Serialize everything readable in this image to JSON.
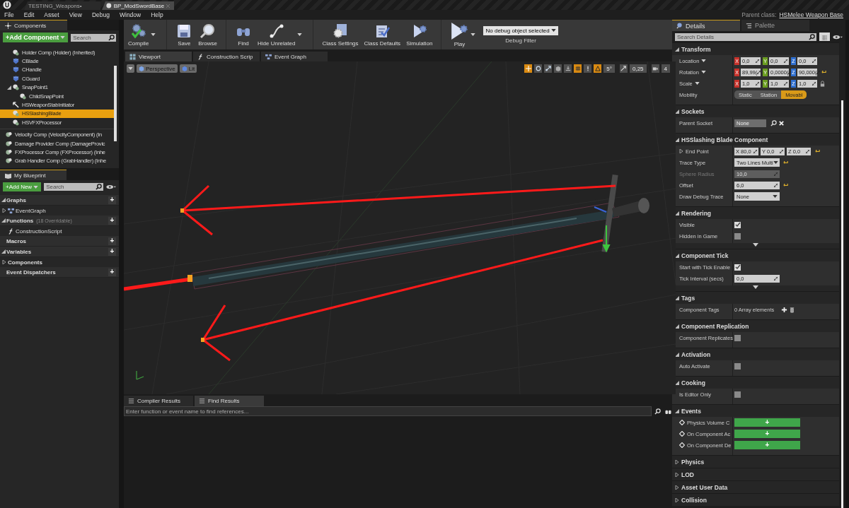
{
  "window": {
    "tabs": [
      {
        "label": "TESTING_Weapons•",
        "selected": false
      },
      {
        "label": "BP_ModSwordBase",
        "selected": true
      }
    ],
    "parent_class_label": "Parent class:",
    "parent_class": "HSMelee Weapon Base"
  },
  "menu": [
    "File",
    "Edit",
    "Asset",
    "View",
    "Debug",
    "Window",
    "Help"
  ],
  "components_panel": {
    "title": "Components",
    "add_button": "+Add Component",
    "search_placeholder": "Search",
    "items": [
      {
        "label": "Holder Comp (Holder) (Inherited)",
        "kind": "scene",
        "selected": false
      },
      {
        "label": "CBlade",
        "kind": "mesh",
        "selected": false
      },
      {
        "label": "CHandle",
        "kind": "mesh",
        "selected": false
      },
      {
        "label": "CGuard",
        "kind": "mesh",
        "selected": false
      },
      {
        "label": "SnapPoint1",
        "kind": "scene",
        "selected": false,
        "expanded": true,
        "children": [
          {
            "label": "ChildSnapPoint",
            "kind": "scene",
            "selected": false
          }
        ]
      },
      {
        "label": "HSWeaponStabInitiator",
        "kind": "arrow",
        "selected": false
      },
      {
        "label": "HSSlashingBlade",
        "kind": "scene",
        "selected": true
      },
      {
        "label": "HSVFXProcessor",
        "kind": "scene",
        "selected": false
      }
    ],
    "inherited_items": [
      {
        "label": "Velocity Comp (VelocityComponent) (In",
        "kind": "actor",
        "selected": false
      },
      {
        "label": "Damage Provider Comp (DamageProvic",
        "kind": "actor",
        "selected": false
      },
      {
        "label": "FXProcessor Comp (FXProcessor) (Inhe",
        "kind": "actor",
        "selected": false
      },
      {
        "label": "Grab Handler Comp (GrabHandler) (Inhe",
        "kind": "actor",
        "selected": false
      }
    ]
  },
  "blueprint_panel": {
    "title": "My Blueprint",
    "add_button": "+Add New",
    "search_placeholder": "Search",
    "sections": [
      {
        "label": "Graphs",
        "expanded": true,
        "add": "+",
        "children": [
          {
            "label": "EventGraph",
            "kind": "graph",
            "expanded": false
          }
        ]
      },
      {
        "label": "Functions",
        "note": "(18 Overridable)",
        "expanded": true,
        "add": "+",
        "children": [
          {
            "label": "ConstructionScript",
            "kind": "function"
          }
        ]
      },
      {
        "label": "Macros",
        "add": "+"
      },
      {
        "label": "Variables",
        "expanded": true,
        "add": "+",
        "children": [
          {
            "label": "Components",
            "kind": "category",
            "expanded": false
          }
        ]
      },
      {
        "label": "Event Dispatchers",
        "add": "+"
      }
    ]
  },
  "toolbar": [
    {
      "label": "Compile",
      "dropdown": true
    },
    {
      "label": "Save",
      "dropdown": false
    },
    {
      "label": "Browse",
      "dropdown": false
    },
    {
      "label": "Find",
      "dropdown": false
    },
    {
      "label": "Hide Unrelated",
      "dropdown": true
    },
    {
      "label": "Class Settings",
      "dropdown": false
    },
    {
      "label": "Class Defaults",
      "dropdown": false
    },
    {
      "label": "Simulation",
      "dropdown": false
    },
    {
      "label": "Play",
      "dropdown": true
    }
  ],
  "debug_filter": {
    "value": "No debug object selected",
    "label": "Debug Filter"
  },
  "editor_tabs": [
    {
      "label": "Viewport",
      "selected": true
    },
    {
      "label": "Construction Scrip",
      "selected": false
    },
    {
      "label": "Event Graph",
      "selected": false
    }
  ],
  "viewport": {
    "view_mode": "Perspective",
    "lighting": "Lit",
    "controls": [
      {
        "kind": "translate",
        "on": true
      },
      {
        "kind": "rotate",
        "on": false
      },
      {
        "kind": "scale",
        "on": false
      },
      {
        "kind": "world",
        "on": false
      },
      {
        "kind": "surface",
        "on": false
      },
      {
        "kind": "grid",
        "on": true
      },
      {
        "kind": "alert",
        "on": false
      },
      {
        "kind": "angle",
        "on": true
      },
      {
        "kind": "value",
        "text": "5°"
      },
      {
        "kind": "resize",
        "on": false
      },
      {
        "kind": "value",
        "text": "0,25"
      },
      {
        "kind": "camera",
        "on": false
      },
      {
        "kind": "value",
        "text": "4"
      }
    ]
  },
  "results_panel": {
    "tabs": [
      {
        "label": "Compiler Results",
        "selected": false
      },
      {
        "label": "Find Results",
        "selected": true
      }
    ],
    "search_placeholder": "Enter function or event name to find references..."
  },
  "details_panel": {
    "tabs": [
      {
        "label": "Details",
        "selected": true
      },
      {
        "label": "Palette",
        "selected": false
      }
    ],
    "search_placeholder": "Search Details",
    "sections": [
      {
        "title": "Transform",
        "expanded": true,
        "advanced": false,
        "rows": [
          {
            "kind": "vector",
            "label": "Location",
            "menu": true,
            "reset": false,
            "lock": false,
            "axes": [
              {
                "axis": "X",
                "value": "0,0",
                "color": "#c8322b"
              },
              {
                "axis": "Y",
                "value": "0,0",
                "color": "#6b9e21"
              },
              {
                "axis": "Z",
                "value": "0,0",
                "color": "#2f6fd0"
              }
            ]
          },
          {
            "kind": "vector",
            "label": "Rotation",
            "menu": true,
            "reset": true,
            "lock": false,
            "axes": [
              {
                "axis": "X",
                "value": "89,99(",
                "color": "#c8322b"
              },
              {
                "axis": "Y",
                "value": "0,0000(",
                "color": "#6b9e21"
              },
              {
                "axis": "Z",
                "value": "90,000(",
                "color": "#2f6fd0"
              }
            ]
          },
          {
            "kind": "vector",
            "label": "Scale",
            "menu": true,
            "reset": false,
            "lock": true,
            "axes": [
              {
                "axis": "X",
                "value": "1,0",
                "color": "#c8322b"
              },
              {
                "axis": "Y",
                "value": "1,0",
                "color": "#6b9e21"
              },
              {
                "axis": "Z",
                "value": "1,0",
                "color": "#2f6fd0"
              }
            ]
          },
          {
            "kind": "segmented",
            "label": "Mobility",
            "options": [
              {
                "label": "Static",
                "selected": false
              },
              {
                "label": "Station",
                "selected": false
              },
              {
                "label": "Movabl",
                "selected": true
              }
            ]
          }
        ]
      },
      {
        "title": "Sockets",
        "expanded": true,
        "advanced": false,
        "rows": [
          {
            "kind": "asset",
            "label": "Parent Socket",
            "value": "None"
          }
        ]
      },
      {
        "title": "HSSlashing Blade Component",
        "expanded": true,
        "advanced": false,
        "rows": [
          {
            "kind": "vector_plain",
            "label": "End Point",
            "expanded": false,
            "reset": true,
            "axes": [
              {
                "axis": "X",
                "value": "80,0"
              },
              {
                "axis": "Y",
                "value": "0,0"
              },
              {
                "axis": "Z",
                "value": "0,0"
              }
            ]
          },
          {
            "kind": "dropdown",
            "label": "Trace Type",
            "value": "Two Lines Multi",
            "reset": true
          },
          {
            "kind": "number",
            "label": "Sphere Radius",
            "value": "10,0",
            "disabled": true,
            "reset": false
          },
          {
            "kind": "number",
            "label": "Offset",
            "value": "6,0",
            "disabled": false,
            "reset": true
          },
          {
            "kind": "dropdown",
            "label": "Draw Debug Trace",
            "value": "None",
            "reset": false
          }
        ]
      },
      {
        "title": "Rendering",
        "expanded": true,
        "advanced": true,
        "rows": [
          {
            "kind": "checkbox",
            "label": "Visible",
            "checked": true
          },
          {
            "kind": "checkbox",
            "label": "Hidden in Game",
            "checked": false
          }
        ]
      },
      {
        "title": "Component Tick",
        "expanded": true,
        "advanced": true,
        "rows": [
          {
            "kind": "checkbox",
            "label": "Start with Tick Enable",
            "checked": true
          },
          {
            "kind": "number",
            "label": "Tick Interval (secs)",
            "value": "0,0",
            "disabled": false,
            "reset": false
          }
        ]
      },
      {
        "title": "Tags",
        "expanded": true,
        "advanced": false,
        "rows": [
          {
            "kind": "array",
            "label": "Component Tags",
            "value": "0 Array elements"
          }
        ]
      },
      {
        "title": "Component Replication",
        "expanded": true,
        "advanced": false,
        "rows": [
          {
            "kind": "checkbox",
            "label": "Component Replicates",
            "checked": false
          }
        ]
      },
      {
        "title": "Activation",
        "expanded": true,
        "advanced": false,
        "rows": [
          {
            "kind": "checkbox",
            "label": "Auto Activate",
            "checked": false
          }
        ]
      },
      {
        "title": "Cooking",
        "expanded": true,
        "advanced": false,
        "rows": [
          {
            "kind": "checkbox",
            "label": "Is Editor Only",
            "checked": false
          }
        ]
      },
      {
        "title": "Events",
        "expanded": true,
        "advanced": false,
        "rows": [
          {
            "kind": "event",
            "label": "Physics Volume C",
            "button": "+"
          },
          {
            "kind": "event",
            "label": "On Component Ac",
            "button": "+"
          },
          {
            "kind": "event",
            "label": "On Component De",
            "button": "+"
          }
        ]
      },
      {
        "title": "Physics",
        "expanded": false
      },
      {
        "title": "LOD",
        "expanded": false
      },
      {
        "title": "Asset User Data",
        "expanded": false
      },
      {
        "title": "Collision",
        "expanded": false
      }
    ]
  }
}
